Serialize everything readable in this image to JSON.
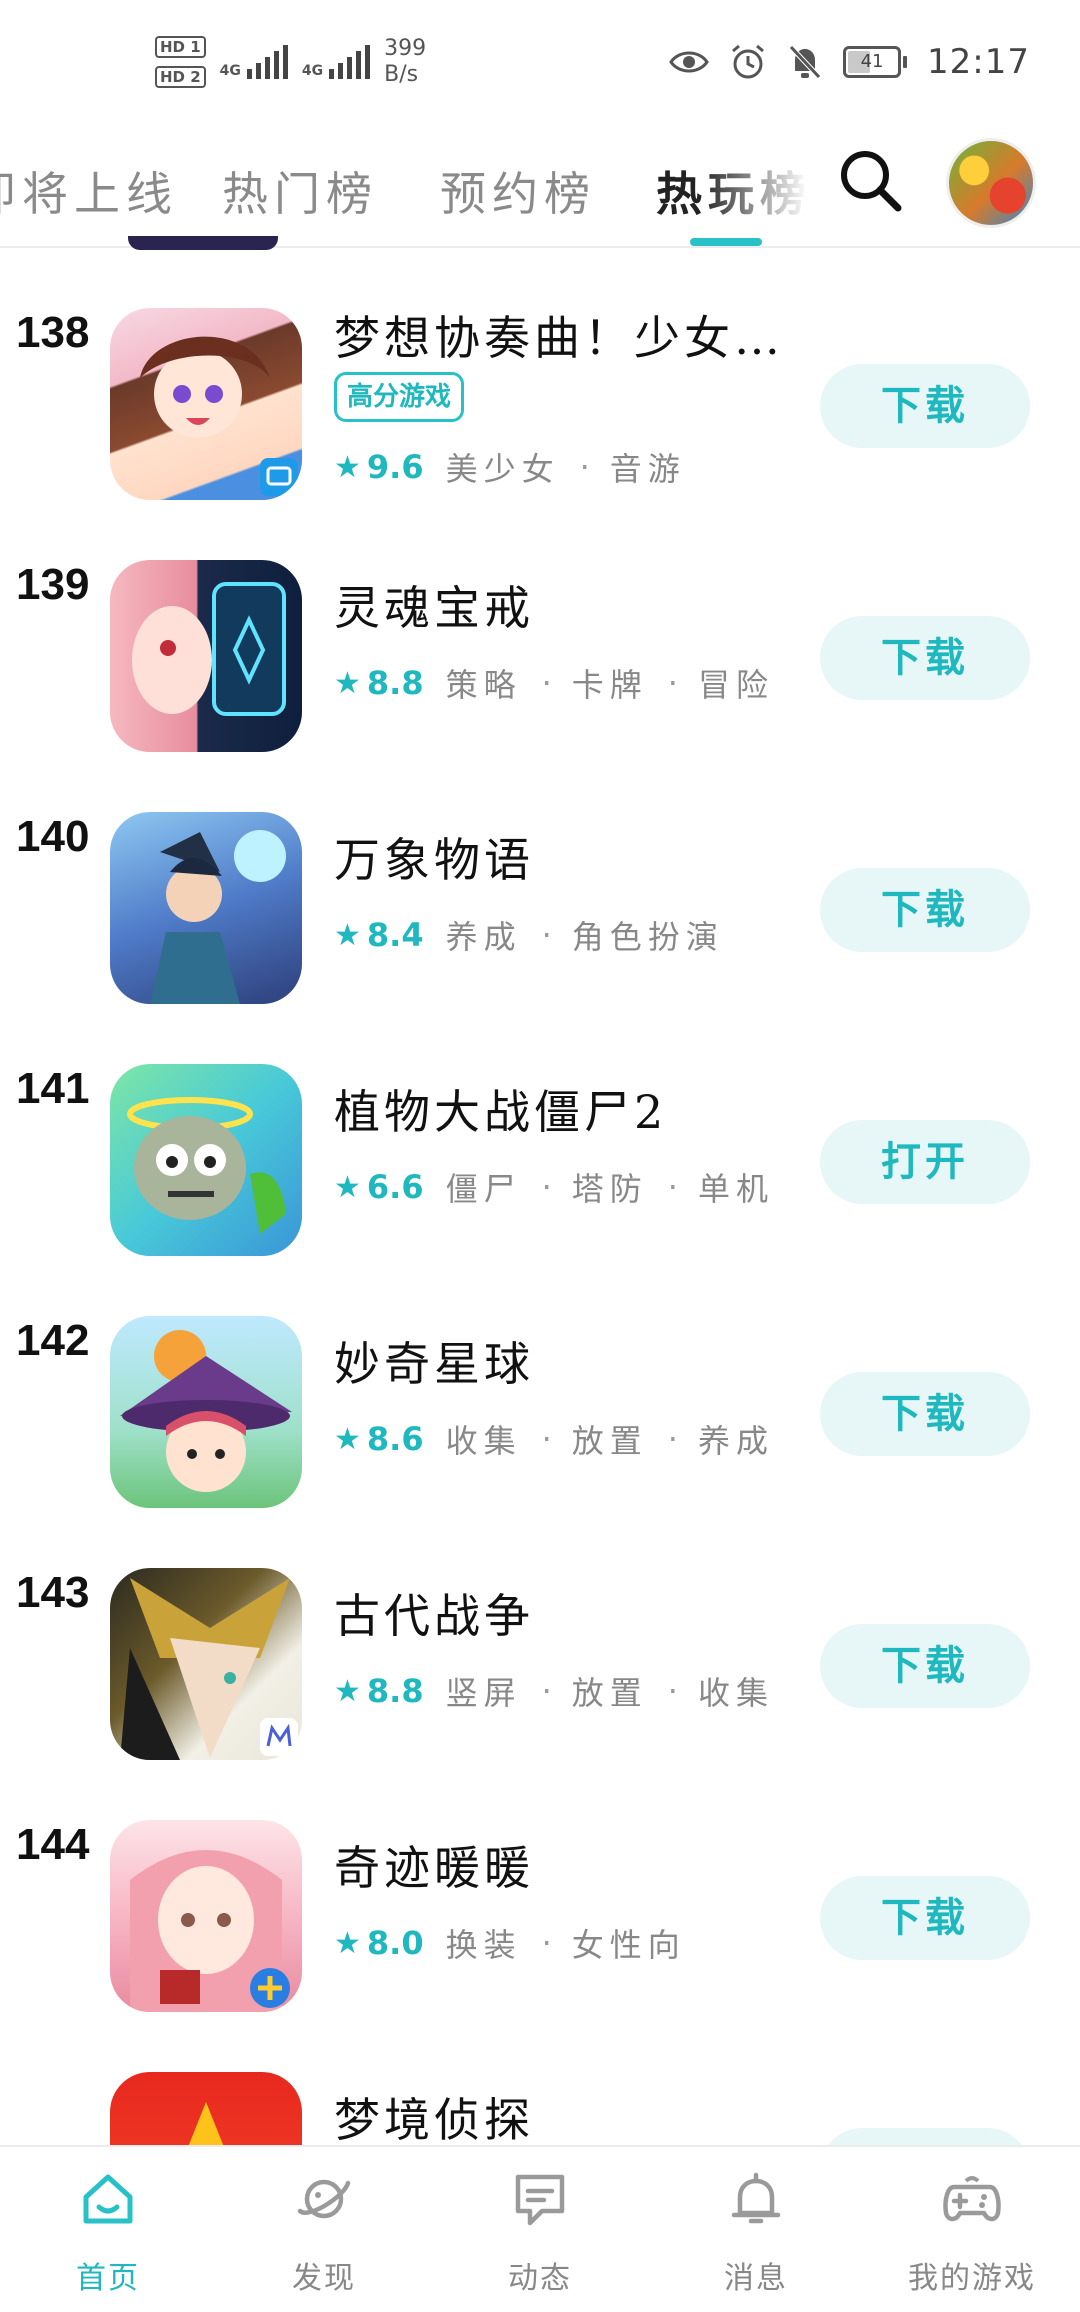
{
  "status_bar": {
    "hd1": "HD 1",
    "hd2": "HD 2",
    "net1": "4G",
    "net2": "4G",
    "speed_value": "399",
    "speed_unit": "B/s",
    "battery": "41",
    "time": "12:17"
  },
  "tabs": [
    {
      "label": "即将上线",
      "active": false
    },
    {
      "label": "热门榜",
      "active": false
    },
    {
      "label": "预约榜",
      "active": false
    },
    {
      "label": "热玩榜",
      "active": true
    }
  ],
  "accent_color": "#27c1c7",
  "games": [
    {
      "rank": "138",
      "name": "梦想协奏曲！少女乐…",
      "badge": "高分游戏",
      "score": "9.6",
      "tags": [
        "美少女",
        "音游"
      ],
      "action": "下载"
    },
    {
      "rank": "139",
      "name": "灵魂宝戒",
      "badge": "",
      "score": "8.8",
      "tags": [
        "策略",
        "卡牌",
        "冒险"
      ],
      "action": "下载"
    },
    {
      "rank": "140",
      "name": "万象物语",
      "badge": "",
      "score": "8.4",
      "tags": [
        "养成",
        "角色扮演"
      ],
      "action": "下载"
    },
    {
      "rank": "141",
      "name": "植物大战僵尸2",
      "badge": "",
      "score": "6.6",
      "tags": [
        "僵尸",
        "塔防",
        "单机"
      ],
      "action": "打开"
    },
    {
      "rank": "142",
      "name": "妙奇星球",
      "badge": "",
      "score": "8.6",
      "tags": [
        "收集",
        "放置",
        "养成"
      ],
      "action": "下载"
    },
    {
      "rank": "143",
      "name": "古代战争",
      "badge": "",
      "score": "8.8",
      "tags": [
        "竖屏",
        "放置",
        "收集"
      ],
      "action": "下载"
    },
    {
      "rank": "144",
      "name": "奇迹暖暖",
      "badge": "",
      "score": "8.0",
      "tags": [
        "换装",
        "女性向"
      ],
      "action": "下载"
    },
    {
      "rank": "",
      "name": "梦境侦探",
      "badge": "",
      "score": "",
      "tags": [],
      "action": ""
    }
  ],
  "bottom_nav": [
    {
      "label": "首页",
      "icon": "home-icon",
      "active": true
    },
    {
      "label": "发现",
      "icon": "planet-icon",
      "active": false
    },
    {
      "label": "动态",
      "icon": "chat-icon",
      "active": false
    },
    {
      "label": "消息",
      "icon": "bell-icon",
      "active": false
    },
    {
      "label": "我的游戏",
      "icon": "gamepad-icon",
      "active": false
    }
  ]
}
